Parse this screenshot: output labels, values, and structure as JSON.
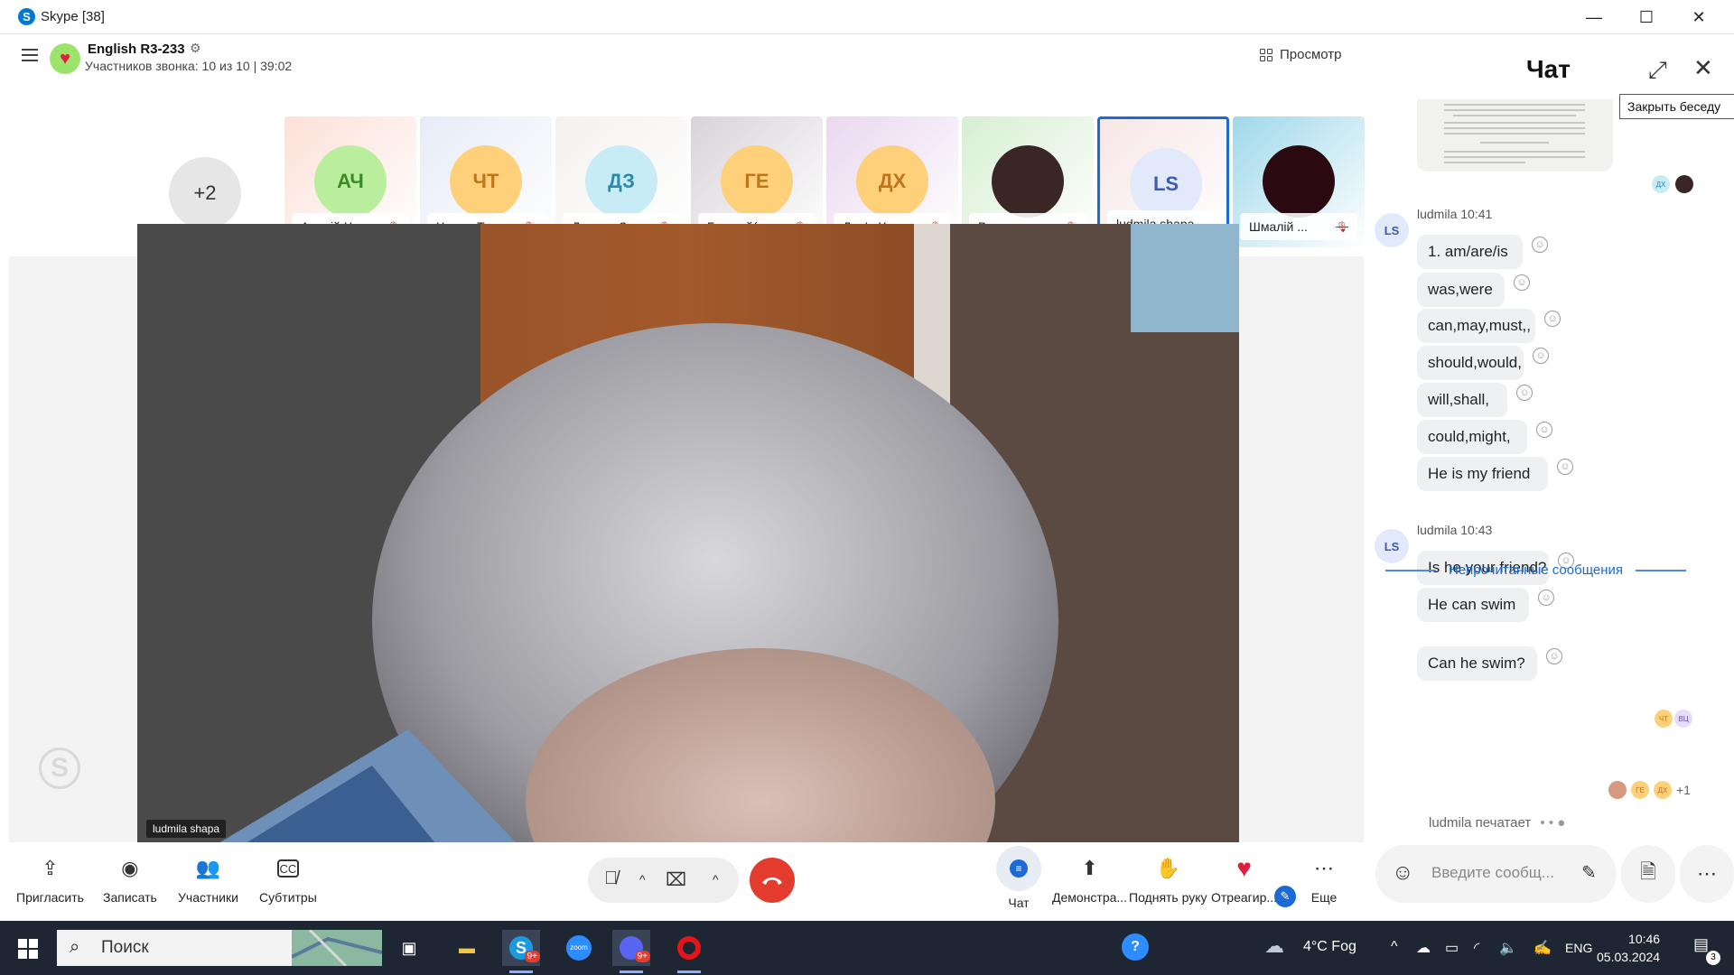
{
  "window": {
    "title": "Skype [38]",
    "minimize_glyph": "—",
    "maximize_glyph": "☐",
    "close_glyph": "✕"
  },
  "call": {
    "group_name": "English R3-233",
    "subtitle": "Участников звонка: 10 из 10 | 39:02",
    "view_label": "Просмотр",
    "overflow_label": "+2",
    "participants": [
      {
        "initials": "АЧ",
        "name": "Андрій Ч...",
        "avatar_color": "#b9ef9c",
        "text_color": "#3c8a2a"
      },
      {
        "initials": "ЧТ",
        "name": "Чивюк Та...",
        "avatar_color": "#ffd07a",
        "text_color": "#c0751a"
      },
      {
        "initials": "ДЗ",
        "name": "Даниил З...",
        "avatar_color": "#c7ecf6",
        "text_color": "#2a8aa8"
      },
      {
        "initials": "ГЕ",
        "name": "Георгий(...",
        "avatar_color": "#ffd07a",
        "text_color": "#c0751a"
      },
      {
        "initials": "ДХ",
        "name": "Дар'я Хо...",
        "avatar_color": "#ffd07a",
        "text_color": "#c0751a"
      },
      {
        "initials": "",
        "name": "Виктория...",
        "avatar_color": "#3b2626",
        "text_color": "#ffffff"
      },
      {
        "initials": "LS",
        "name": "ludmila shapa",
        "avatar_color": "#e1e9fb",
        "text_color": "#3b5bb0"
      },
      {
        "initials": "",
        "name": "Шмалій ...",
        "avatar_color": "#2a0a10",
        "text_color": "#ffffff"
      }
    ],
    "main_video_name": "ludmila shapa",
    "toolbar": {
      "invite": "Пригласить",
      "record": "Записать",
      "participants": "Участники",
      "subtitles": "Субтитры",
      "chat": "Чат",
      "share": "Демонстра...",
      "raise_hand": "Поднять руку",
      "react": "Отреагир...",
      "more": "Еще"
    }
  },
  "chat": {
    "title": "Чат",
    "tooltip": "Закрыть беседу",
    "image_read_by": [
      "ДХ"
    ],
    "groups": [
      {
        "sender": "ludmila 10:41",
        "avatar": "LS",
        "messages": [
          "1. am/are/is",
          "was,were",
          "can,may,must,,",
          "should,would,",
          "will,shall,",
          "could,might,",
          "He is my friend"
        ]
      },
      {
        "sender": "ludmila 10:43",
        "avatar": "LS",
        "messages": [
          "Is he your friend?",
          "He can swim",
          "Can he swim?"
        ]
      }
    ],
    "read_receipts_1": [
      "ЧТ",
      "ВЦ"
    ],
    "read_receipts_2": [
      "ГЕ",
      "ДХ"
    ],
    "read_more": "+1",
    "unread_divider": "Непрочитанные сообщения",
    "typing": "ludmila печатает",
    "composer_placeholder": "Введите сообщ..."
  },
  "taskbar": {
    "search_placeholder": "Поиск",
    "skype_badge": "9+",
    "discord_badge": "9+",
    "zoom_label": "zoom",
    "weather": "4°C Fog",
    "language": "ENG",
    "time": "10:46",
    "date": "05.03.2024",
    "notifications": "3"
  },
  "colors": {
    "accent": "#1c6ad6",
    "end_call": "#e33b2e",
    "taskbar": "#1f2633"
  }
}
